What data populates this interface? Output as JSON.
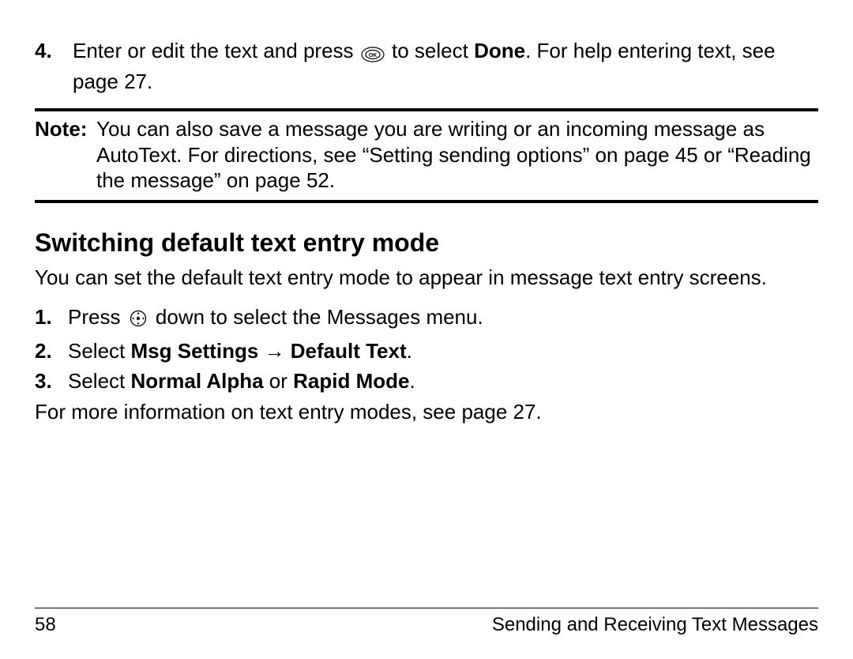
{
  "step4": {
    "num": "4.",
    "before_icon": "Enter or edit the text and press ",
    "after_icon_before_bold": " to select ",
    "bold": "Done",
    "after_bold": ". For help entering text, see page 27."
  },
  "note": {
    "label": "Note:",
    "text": "You can also save a message you are writing or an incoming message as AutoText. For directions, see “Setting sending options” on page 45 or “Reading the message” on page 52."
  },
  "section_title": "Switching default text entry mode",
  "intro": "You can set the default text entry mode to appear in message text entry screens.",
  "steps": [
    {
      "num": "1.",
      "before_icon": "Press ",
      "after_icon": " down to select the Messages menu.",
      "has_nav_icon": true
    },
    {
      "num": "2.",
      "plain_before": "Select ",
      "bold1": "Msg Settings",
      "arrow_spaced": " → ",
      "bold2": "Default Text",
      "tail": "."
    },
    {
      "num": "3.",
      "plain_before": "Select ",
      "bold1": "Normal Alpha",
      "mid": " or ",
      "bold2": "Rapid Mode",
      "tail": "."
    }
  ],
  "after_steps": "For more information on text entry modes, see page 27.",
  "footer": {
    "page": "58",
    "chapter": "Sending and Receiving Text Messages"
  }
}
